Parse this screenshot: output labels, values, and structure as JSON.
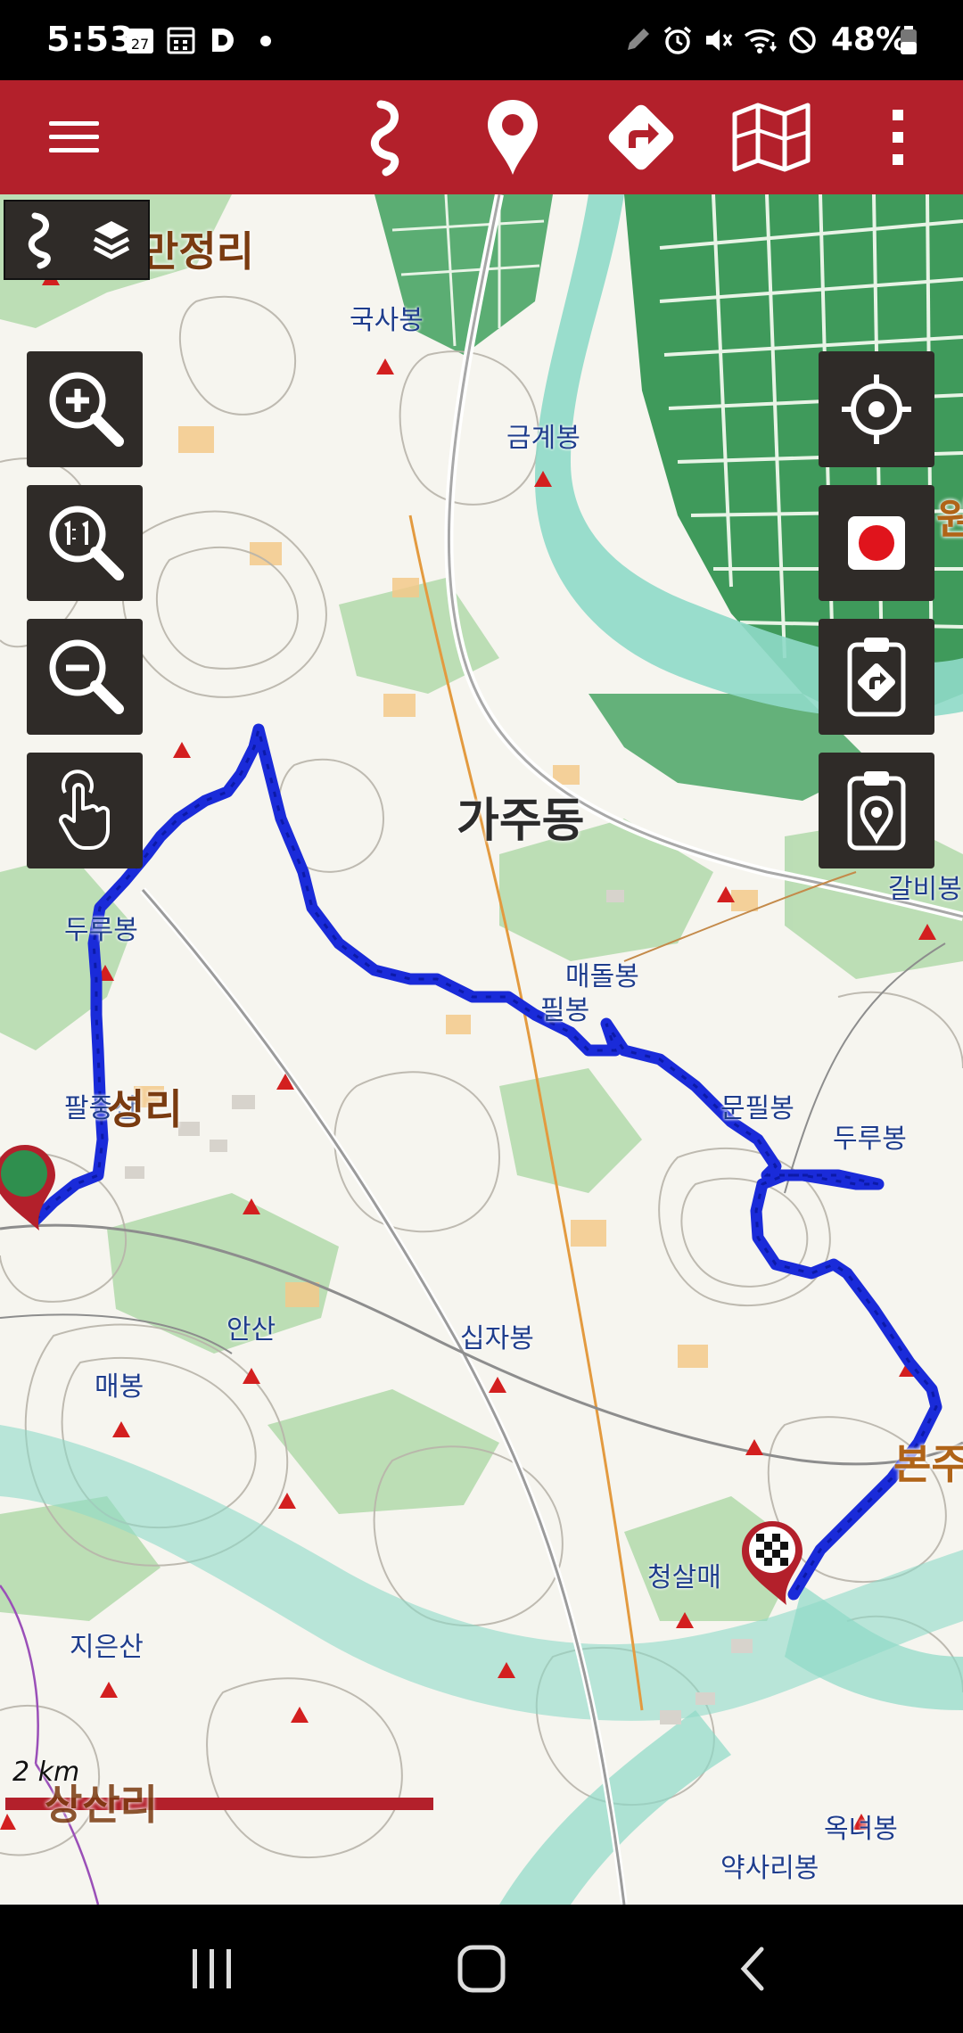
{
  "status_bar": {
    "time": "5:53",
    "calendar_badge": "27",
    "battery": "48%"
  },
  "toolbar": {
    "icons": [
      "menu-icon",
      "route-icon",
      "waypoint-icon",
      "navigate-icon",
      "map-icon",
      "more-vertical-icon"
    ]
  },
  "map": {
    "labels": {
      "manjeong": "만정리",
      "guksa": "국사봉",
      "geumgye": "금계봉",
      "gaju": "가주동",
      "galbi": "갈비봉",
      "duru_w": "두루봉",
      "maedol": "매돌봉",
      "pil": "필봉",
      "munpil": "문필봉",
      "duru_e": "두루봉",
      "paljung": "팔중산",
      "ri_w": "성리",
      "an": "안산",
      "sipja": "십자봉",
      "mae": "매봉",
      "cheongsal": "청살매",
      "jieun": "지은산",
      "sangsa": "상산리",
      "oknyeo": "옥녀봉",
      "yaksari": "약사리봉",
      "bonju": "본주",
      "won": "원"
    },
    "scale_label": "2 km",
    "route_color": "#1a2bd9",
    "accent": "#b3202b"
  },
  "left_controls": [
    "zoom-in-icon",
    "zoom-reset-icon",
    "zoom-out-icon",
    "touch-icon"
  ],
  "right_controls": [
    "locate-icon",
    "record-icon",
    "route-clipboard-icon",
    "waypoint-clipboard-icon"
  ]
}
